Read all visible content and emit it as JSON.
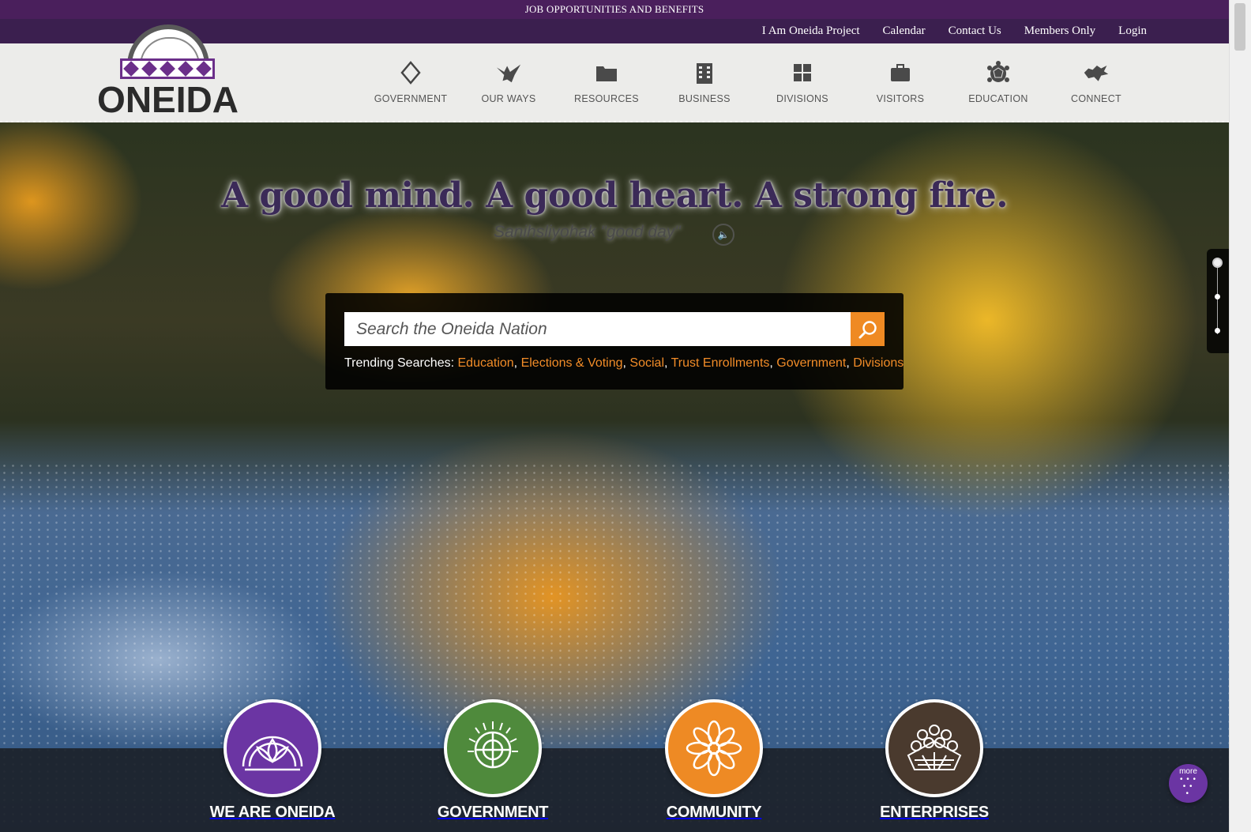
{
  "promo": {
    "text": "JOB OPPORTUNITIES AND BENEFITS"
  },
  "utility_nav": [
    {
      "label": "I Am Oneida Project"
    },
    {
      "label": "Calendar"
    },
    {
      "label": "Contact Us"
    },
    {
      "label": "Members Only"
    },
    {
      "label": "Login"
    }
  ],
  "logo": {
    "text": "ONEIDA"
  },
  "main_nav": [
    {
      "label": "GOVERNMENT",
      "icon": "diamond-icon"
    },
    {
      "label": "OUR WAYS",
      "icon": "eagle-icon"
    },
    {
      "label": "RESOURCES",
      "icon": "folder-icon"
    },
    {
      "label": "BUSINESS",
      "icon": "building-icon"
    },
    {
      "label": "DIVISIONS",
      "icon": "grid-icon"
    },
    {
      "label": "VISITORS",
      "icon": "suitcase-icon"
    },
    {
      "label": "EDUCATION",
      "icon": "turtle-icon"
    },
    {
      "label": "CONNECT",
      "icon": "wolf-icon"
    }
  ],
  "hero": {
    "tagline": "A good mind. A good heart. A strong fire.",
    "greeting": "Sanihsliyohak \"good day\""
  },
  "search": {
    "placeholder": "Search the Oneida Nation",
    "trending_label": "Trending Searches:",
    "trending": [
      "Education",
      "Elections & Voting",
      "Social",
      "Trust Enrollments",
      "Government",
      "Divisions"
    ]
  },
  "features": [
    {
      "label": "WE ARE ONEIDA",
      "color": "#6b35a3",
      "icon": "sky-dome-icon"
    },
    {
      "label": "GOVERNMENT",
      "color": "#4f8a3c",
      "icon": "tree-of-peace-icon"
    },
    {
      "label": "COMMUNITY",
      "color": "#ee8a24",
      "icon": "flower-icon"
    },
    {
      "label": "ENTERPRISES",
      "color": "#4a3a2e",
      "icon": "basket-icon"
    }
  ],
  "more": {
    "label": "more"
  },
  "colors": {
    "purple_bar": "#4a1f5c",
    "accent_orange": "#ef8a23",
    "brand_purple": "#6b2f8a"
  }
}
